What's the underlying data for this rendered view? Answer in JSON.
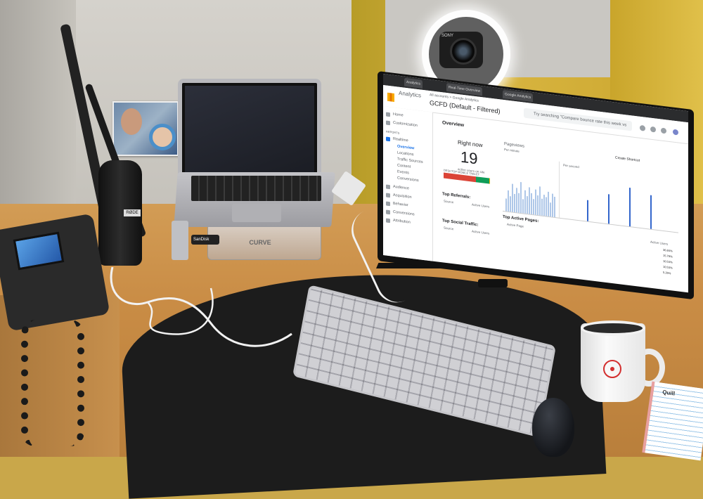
{
  "photo": {
    "subject_icon": "family-photo"
  },
  "laptop": {
    "stand_label": "CURVE"
  },
  "usb_stick": {
    "label": "SanDisk"
  },
  "webcam": {
    "brand": "SONY"
  },
  "mic": {
    "label": "RØDE"
  },
  "monitor": {
    "browser_tabs": [
      "Analytics",
      "Real-Time Overview",
      "Google Analytics"
    ],
    "analytics": {
      "app_name": "Analytics",
      "property_path": "All accounts > Google Analytics",
      "view_name": "GCFD (Default - Filtered)",
      "search_placeholder": "Try searching \"Compare bounce rate this week vs",
      "sidebar": {
        "home": "Home",
        "customization": "Customization",
        "reports_label": "REPORTS",
        "realtime": "Realtime",
        "overview": "Overview",
        "locations": "Locations",
        "traffic_sources": "Traffic Sources",
        "content": "Content",
        "events": "Events",
        "conversions": "Conversions",
        "audience": "Audience",
        "acquisition": "Acquisition",
        "behavior": "Behavior",
        "conversions_main": "Conversions",
        "attribution": "Attribution"
      },
      "overview_title": "Overview",
      "right_now_label": "Right now",
      "right_now_value": "19",
      "right_now_sub": "active users on site",
      "device_legend": "DESKTOP  MOBILE  TABLET",
      "device_split": [
        0.69,
        0.29,
        0.02
      ],
      "device_colors": [
        "#db4437",
        "#0f9d58",
        "#f4b400"
      ],
      "pageviews_title": "Pageviews",
      "pageviews_sub": "Per minute",
      "per_second_label": "Per second",
      "create_shortcut": "Create Shortcut",
      "top_referrals_title": "Top Referrals:",
      "top_referrals_cols": [
        "Source",
        "Active Users"
      ],
      "top_social_title": "Top Social Traffic:",
      "top_social_cols": [
        "Source",
        "Active Users"
      ],
      "top_pages_title": "Top Active Pages:",
      "top_pages_cols": [
        "Active Page",
        "Active Users"
      ],
      "top_pages_pcts": [
        "36.84%",
        "15.79%",
        "10.53%",
        "10.53%",
        "5.26%"
      ],
      "header_icons": [
        "apps-icon",
        "help-icon",
        "settings-icon",
        "account-icon"
      ]
    }
  },
  "notepad": {
    "brand": "Quill"
  }
}
